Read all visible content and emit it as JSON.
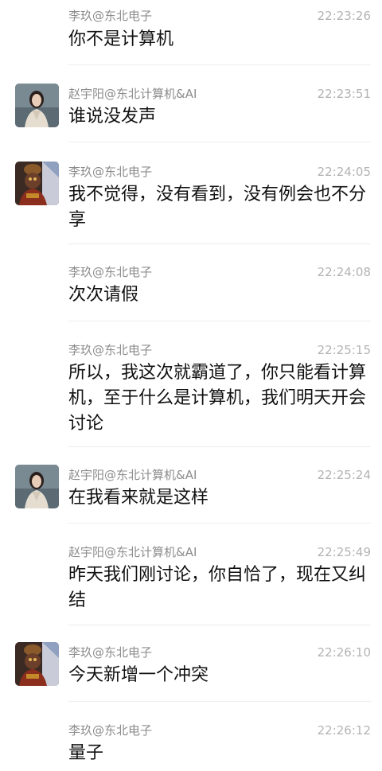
{
  "messages": [
    {
      "sender": "李玖@东北电子",
      "time": "22:23:26",
      "text": "你不是计算机",
      "avatar": ""
    },
    {
      "sender": "赵宇阳@东北计算机&AI",
      "time": "22:23:51",
      "text": "谁说没发声",
      "avatar": "woman-avatar"
    },
    {
      "sender": "李玖@东北电子",
      "time": "22:24:05",
      "text": "我不觉得，没有看到，没有例会也不分享",
      "avatar": "statue-avatar"
    },
    {
      "sender": "李玖@东北电子",
      "time": "22:24:08",
      "text": "次次请假",
      "avatar": ""
    },
    {
      "sender": "李玖@东北电子",
      "time": "22:25:15",
      "text": "所以，我这次就霸道了，你只能看计算机，至于什么是计算机，我们明天开会讨论",
      "avatar": ""
    },
    {
      "sender": "赵宇阳@东北计算机&AI",
      "time": "22:25:24",
      "text": "在我看来就是这样",
      "avatar": "woman-avatar"
    },
    {
      "sender": "赵宇阳@东北计算机&AI",
      "time": "22:25:49",
      "text": "昨天我们刚讨论，你自恰了，现在又纠结",
      "avatar": ""
    },
    {
      "sender": "李玖@东北电子",
      "time": "22:26:10",
      "text": "今天新增一个冲突",
      "avatar": "statue-avatar"
    },
    {
      "sender": "李玖@东北电子",
      "time": "22:26:12",
      "text": "量子",
      "avatar": ""
    }
  ],
  "colors": {
    "sender": "#8c8c8c",
    "time": "#b3b3b3",
    "text": "#111111",
    "divider": "#ededed"
  }
}
